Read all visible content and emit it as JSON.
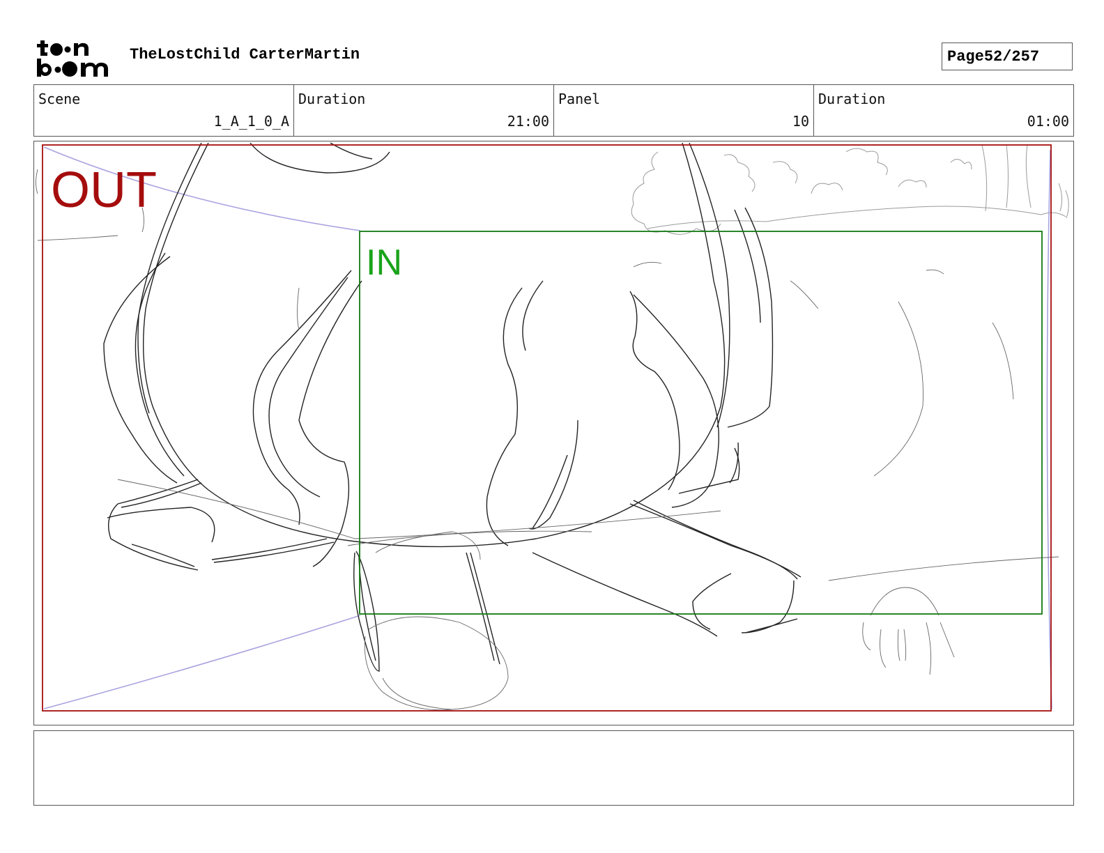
{
  "header": {
    "project_title": "TheLostChild CarterMartin",
    "page_label": "Page",
    "page_value": "52/257"
  },
  "info": {
    "scene_label": "Scene",
    "scene_value": "1_A_1_0_A",
    "scene_duration_label": "Duration",
    "scene_duration_value": "21:00",
    "panel_label": "Panel",
    "panel_value": "10",
    "panel_duration_label": "Duration",
    "panel_duration_value": "01:00"
  },
  "panel": {
    "out_label": "OUT",
    "in_label": "IN",
    "colors": {
      "out": "#a50d0d",
      "in": "#127a12",
      "camera_path": "#a9a3e0",
      "sketch": "#222222"
    }
  },
  "caption": {
    "text": ""
  }
}
